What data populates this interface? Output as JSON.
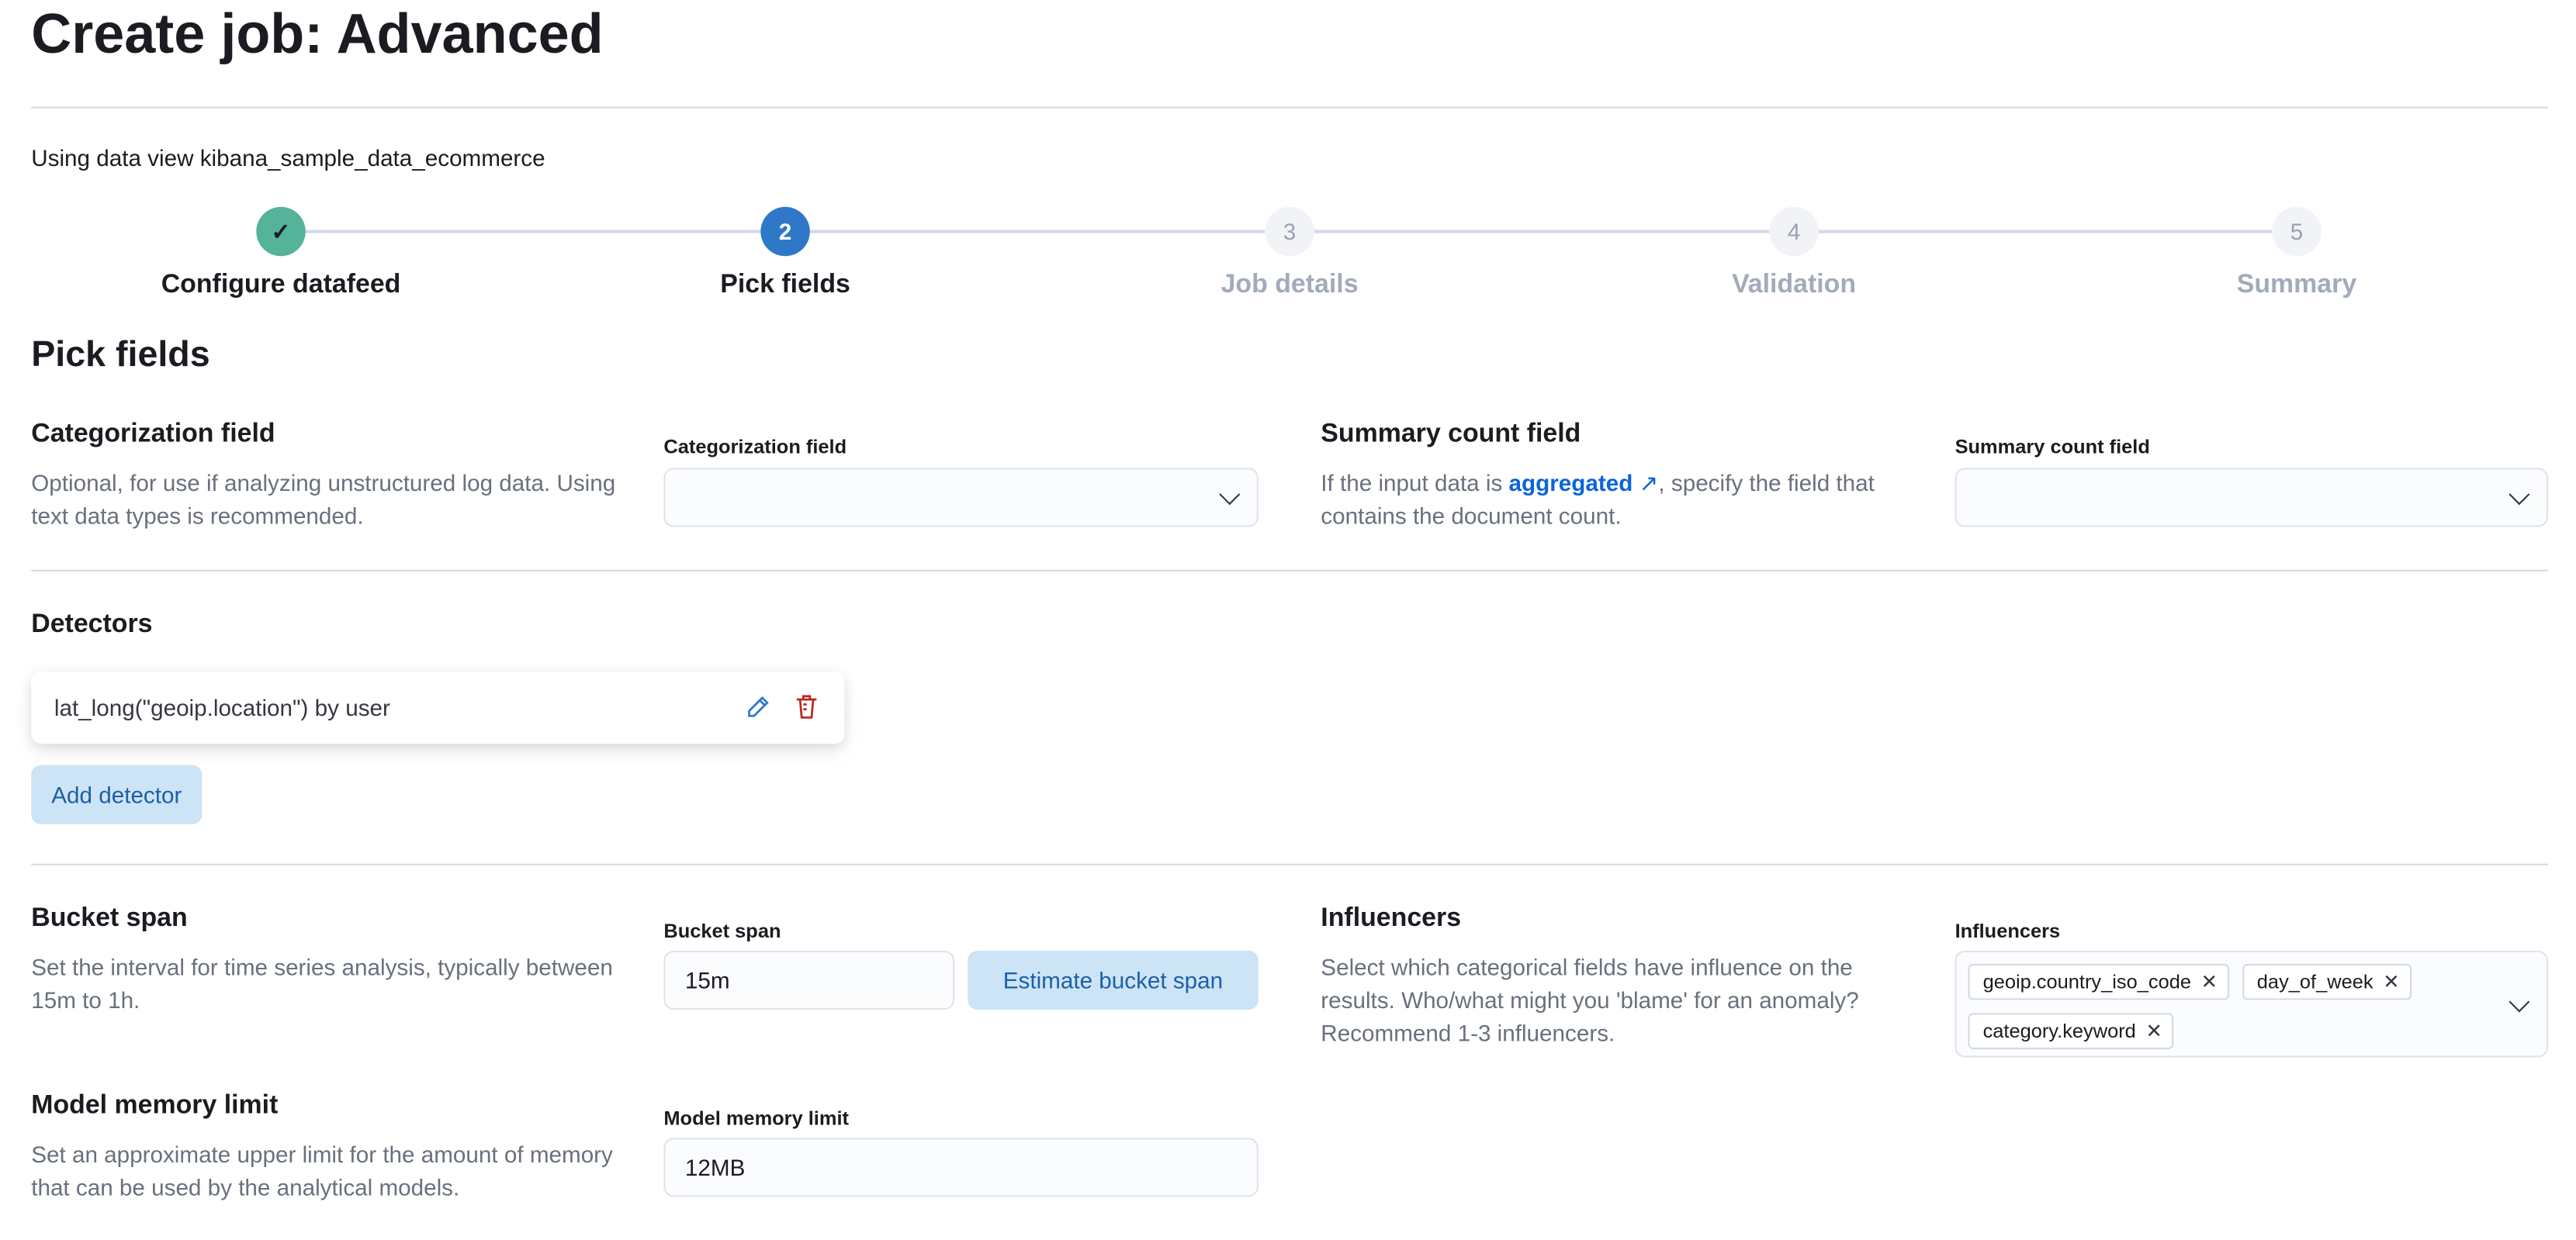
{
  "page": {
    "title": "Create job: Advanced",
    "data_view_text": "Using data view kibana_sample_data_ecommerce"
  },
  "steps": [
    {
      "number": "✓",
      "label": "Configure datafeed",
      "status": "complete"
    },
    {
      "number": "2",
      "label": "Pick fields",
      "status": "current"
    },
    {
      "number": "3",
      "label": "Job details",
      "status": "incomplete"
    },
    {
      "number": "4",
      "label": "Validation",
      "status": "incomplete"
    },
    {
      "number": "5",
      "label": "Summary",
      "status": "incomplete"
    }
  ],
  "pick_fields": {
    "heading": "Pick fields",
    "categorization": {
      "title": "Categorization field",
      "description": "Optional, for use if analyzing unstructured log data. Using text data types is recommended.",
      "field_label": "Categorization field",
      "value": ""
    },
    "summary_count": {
      "title": "Summary count field",
      "desc_before": "If the input data is ",
      "link": "aggregated",
      "desc_after": ", specify the field that contains the document count.",
      "field_label": "Summary count field",
      "value": ""
    },
    "detectors": {
      "title": "Detectors",
      "items": [
        {
          "label": "lat_long(\"geoip.location\") by user"
        }
      ],
      "add_label": "Add detector"
    },
    "bucket_span": {
      "title": "Bucket span",
      "description": "Set the interval for time series analysis, typically between 15m to 1h.",
      "field_label": "Bucket span",
      "value": "15m",
      "estimate_label": "Estimate bucket span"
    },
    "influencers": {
      "title": "Influencers",
      "description": "Select which categorical fields have influence on the results. Who/what might you 'blame' for an anomaly? Recommend 1-3 influencers.",
      "field_label": "Influencers",
      "selected": [
        "geoip.country_iso_code",
        "day_of_week",
        "category.keyword"
      ]
    },
    "model_memory": {
      "title": "Model memory limit",
      "description": "Set an approximate upper limit for the amount of memory that can be used by the analytical models.",
      "field_label": "Model memory limit",
      "value": "12MB"
    }
  },
  "colors": {
    "complete": "#54b399",
    "current": "#0b64dd",
    "incomplete_label": "#a2abba",
    "link": "#0b64dd",
    "delete": "#bd271e"
  }
}
